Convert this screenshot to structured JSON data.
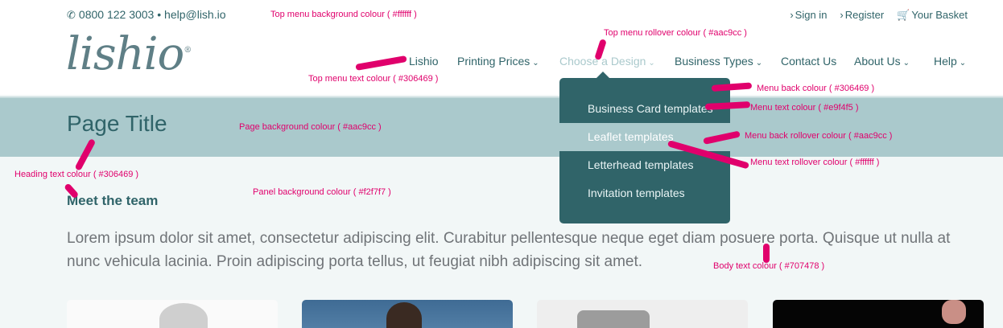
{
  "colors": {
    "top_menu_background": "#ffffff",
    "top_menu_text": "#306469",
    "top_menu_rollover": "#aac9cc",
    "page_background": "#aac9cc",
    "heading_text": "#306469",
    "panel_background": "#f2f7f7",
    "menu_back": "#306469",
    "menu_text": "#e9f4f5",
    "menu_back_rollover": "#aac9cc",
    "menu_text_rollover": "#ffffff",
    "body_text": "#707478",
    "annotation": "#e0006c"
  },
  "contact": {
    "phone_icon": "phone-icon",
    "phone": "0800 122 3003",
    "separator": "•",
    "email": "help@lish.io"
  },
  "utility": {
    "sign_in": "Sign in",
    "register": "Register",
    "basket": "Your Basket",
    "chevron": "›",
    "basket_icon": "cart-icon"
  },
  "logo": {
    "text": "lishio",
    "mark": "®"
  },
  "nav": {
    "lishio": "Lishio",
    "printing_prices": "Printing Prices",
    "choose_design": "Choose a Design",
    "business_types": "Business Types",
    "contact_us": "Contact Us",
    "about_us": "About Us",
    "help": "Help",
    "caret": "⌄"
  },
  "dropdown": {
    "items": [
      "Business Card templates",
      "Leaflet templates",
      "Letterhead templates",
      "Invitation templates"
    ]
  },
  "page": {
    "title": "Page Title",
    "heading": "Meet the team",
    "body": "Lorem ipsum dolor sit amet, consectetur adipiscing elit. Curabitur pellentesque neque eget diam posuere porta. Quisque ut nulla at nunc vehicula lacinia. Proin adipiscing porta tellus, ut feugiat nibh adipiscing sit amet."
  },
  "annotations": {
    "top_menu_background": "Top menu background colour ( #ffffff )",
    "top_menu_rollover": "Top menu rollover colour ( #aac9cc )",
    "top_menu_text": "Top menu text colour ( #306469 )",
    "menu_back": "Menu back colour ( #306469 )",
    "menu_text": "Menu text colour ( #e9f4f5 )",
    "page_background": "Page background colour ( #aac9cc )",
    "menu_back_rollover": "Menu back rollover colour ( #aac9cc )",
    "menu_text_rollover": "Menu text rollover colour ( #ffffff )",
    "heading_text": "Heading text colour ( #306469 )",
    "panel_background": "Panel background colour ( #f2f7f7 )",
    "body_text": "Body text colour ( #707478 )"
  }
}
